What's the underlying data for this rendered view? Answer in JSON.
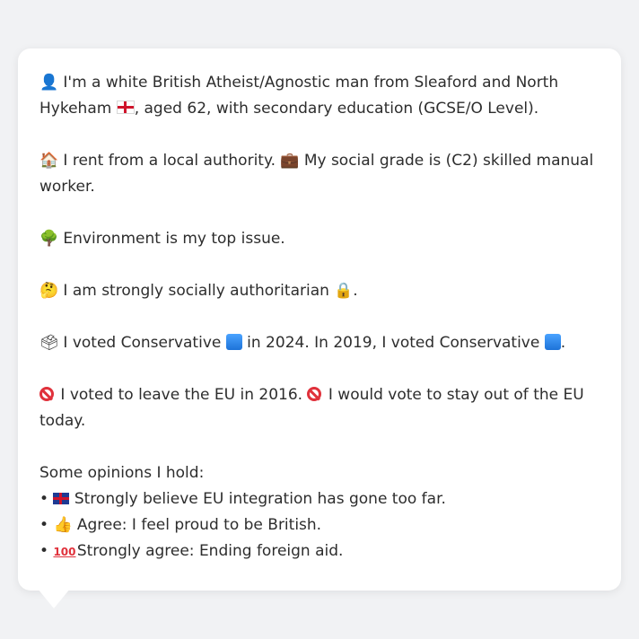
{
  "profile": {
    "line1": "I'm a white British Atheist/Agnostic man from Sleaford and North Hykeham",
    "line1_suffix": ", aged 62, with secondary education (GCSE/O Level).",
    "line2a": "I rent from a local authority.",
    "line2b": "My social grade is (C2) skilled manual worker.",
    "line3": "Environment is my top issue.",
    "line4": "I am strongly socially authoritarian",
    "line4_end": ".",
    "line5a": "I voted Conservative",
    "line5b": "in 2024. In 2019, I voted Conservative",
    "line5_end": ".",
    "line6a": "I voted to leave the EU in 2016.",
    "line6b": "I would vote to stay out of the EU today.",
    "opinions_heading": "Some opinions I hold:",
    "opinions": [
      "Strongly believe EU integration has gone too far.",
      "Agree: I feel proud to be British.",
      "Strongly agree: Ending foreign aid."
    ],
    "bullet": "•"
  },
  "icons": {
    "person": "bust-silhouette-icon",
    "house": "house-icon",
    "briefcase": "briefcase-icon",
    "tree": "tree-icon",
    "thinking": "thinking-face-icon",
    "lock": "lock-icon",
    "ballot": "ballot-box-icon",
    "conservative_square": "blue-square-icon",
    "no_entry": "no-entry-icon",
    "uk_flag": "uk-flag-icon",
    "thumbs_up": "thumbs-up-icon",
    "hundred": "hundred-points-icon",
    "england_flag": "england-flag-icon"
  },
  "colors": {
    "background": "#f1f2f4",
    "card": "#ffffff",
    "text": "#2d2d2d",
    "conservative_blue": "#1d73d8"
  }
}
